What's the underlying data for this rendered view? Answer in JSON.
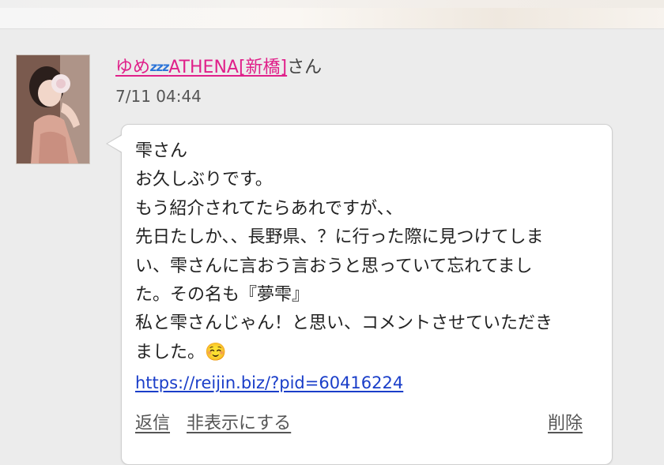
{
  "comment": {
    "user_name": "ゆめ",
    "sleep_icon": "zzz-icon",
    "shop_name": "ATHENA[新橋]",
    "honorific": "さん",
    "timestamp": "7/11 04:44",
    "message_lines": [
      "雫さん",
      "お久しぶりです。",
      "もう紹介されてたらあれですが、、",
      "先日たしか、、長野県、？に行った際に見つけてしま",
      "い、雫さんに言おう言おうと思っていて忘れてまし",
      "た。その名も『夢雫』",
      "私と雫さんじゃん！と思い、コメントさせていただき",
      "ました。"
    ],
    "emoji": "☺️",
    "link": "https://reijin.biz/?pid=60416224"
  },
  "actions": {
    "reply": "返信",
    "hide": "非表示にする",
    "delete": "削除"
  },
  "colors": {
    "username": "#e0208a",
    "link": "#1a3ec9",
    "background": "#ececec"
  }
}
